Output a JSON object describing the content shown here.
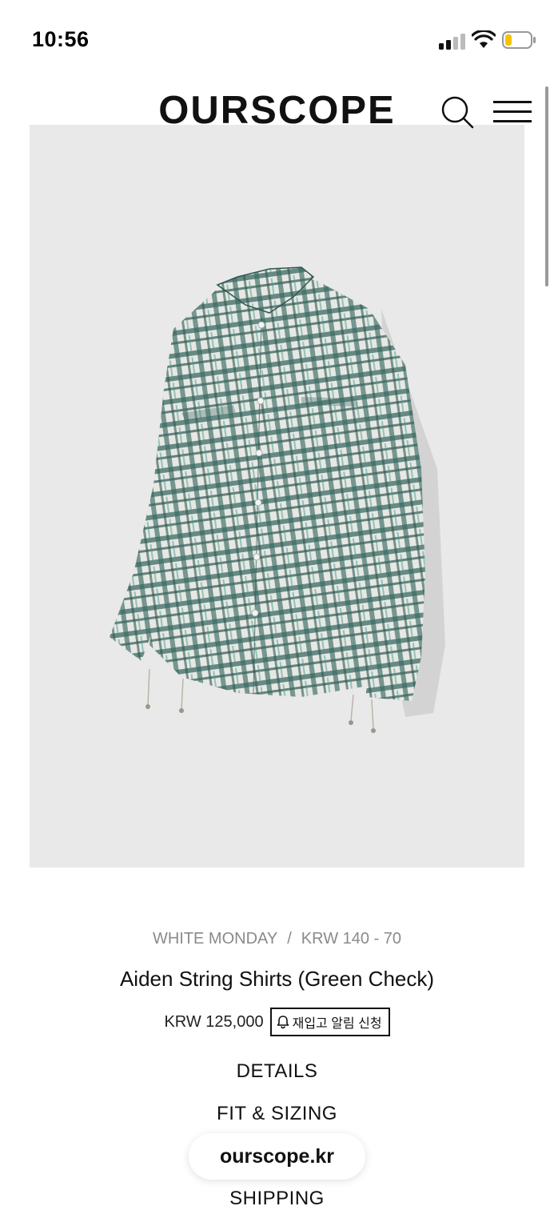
{
  "status_bar": {
    "time": "10:56",
    "signal_icon": "cellular-signal-icon",
    "wifi_icon": "wifi-icon",
    "battery_icon": "battery-low-icon",
    "battery_color": "#f5c400"
  },
  "header": {
    "brand": "OURSCOPE",
    "search_icon": "search-icon",
    "menu_icon": "hamburger-menu-icon"
  },
  "product": {
    "image_alt_icon": "green-check-shirt-image",
    "brand_label": "WHITE MONDAY",
    "separator": "/",
    "size_label": "KRW 140 - 70",
    "title": "Aiden String Shirts (Green Check)",
    "price": "KRW 125,000",
    "restock_button": "재입고 알림 신청",
    "restock_icon": "bell-icon"
  },
  "sections": {
    "details": "DETAILS",
    "fit_sizing": "FIT & SIZING",
    "shipping": "SHIPPING"
  },
  "browser": {
    "url": "ourscope.kr"
  },
  "colors": {
    "image_bg": "#e9e9e9",
    "shirt_green": "#3b6a62",
    "shirt_light": "#e6e8e4",
    "meta_gray": "#8a8a8a"
  }
}
